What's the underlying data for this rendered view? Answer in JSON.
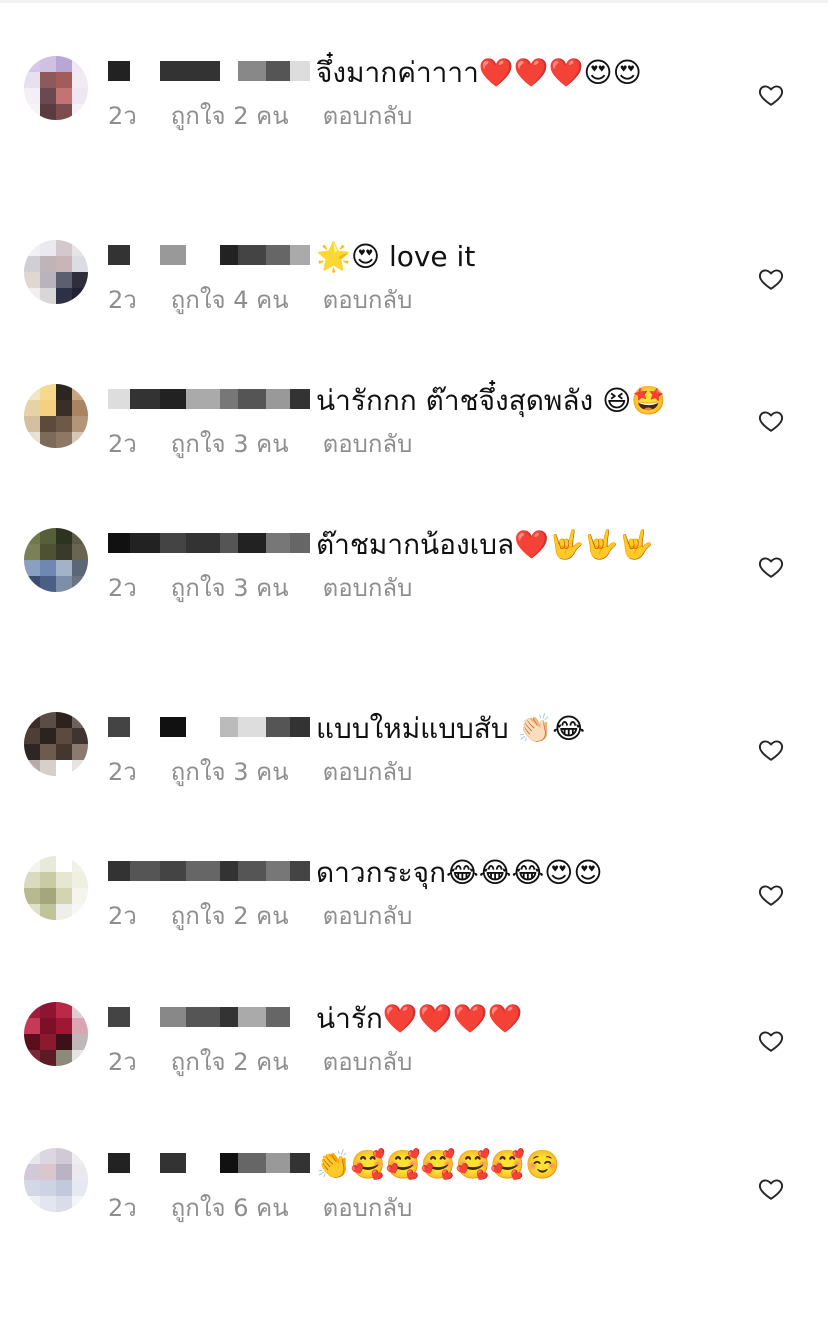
{
  "labels": {
    "likes_prefix": "ถูกใจ",
    "likes_suffix": "คน",
    "reply": "ตอบกลับ"
  },
  "comments": [
    {
      "text": "จึ๋งมากค่าาาา❤️❤️❤️😍😍",
      "time": "2ว",
      "likes_count": "2",
      "avatar_colors": [
        "#d8c6e8",
        "#cfc1e2",
        "#b9a6d4",
        "#efe7f5",
        "#e9e0ef",
        "#8c5a5a",
        "#a35b5b",
        "#f1ecf4",
        "#f4eef6",
        "#6b4a4f",
        "#c27474",
        "#eee7f1",
        "#f7f3f8",
        "#5a3b40",
        "#7d4c4f",
        "#f5f1f6"
      ],
      "mosaic": [
        "#222",
        "#fff",
        "#333",
        "#333",
        "#fff",
        "#888",
        "#555",
        "#ddd"
      ]
    },
    {
      "text": "🌟😍 love it",
      "time": "2ว",
      "likes_count": "4",
      "avatar_colors": [
        "#f1f1f1",
        "#e9e9ef",
        "#d3c8cc",
        "#e5e5e8",
        "#cfcfd6",
        "#bfb4b8",
        "#c9b5b5",
        "#dcdde4",
        "#e1d7d1",
        "#b9b4bc",
        "#5b5f70",
        "#2f2f3c",
        "#f3eeee",
        "#d8d6d6",
        "#2d3146",
        "#1f2233"
      ],
      "mosaic": [
        "#333",
        "#fff",
        "#999",
        "#fff",
        "#222",
        "#444",
        "#666",
        "#aaa"
      ]
    },
    {
      "text": "น่ารักกก ต๊าชจึ๋งสุดพลัง 😆🤩",
      "time": "2ว",
      "likes_count": "3",
      "avatar_colors": [
        "#f0e6c8",
        "#f6d98d",
        "#2b2620",
        "#c9a37e",
        "#e6d2a4",
        "#f3d181",
        "#3a2f27",
        "#a88462",
        "#d4bfa0",
        "#5c4a3c",
        "#6e5948",
        "#b39679",
        "#eae1d5",
        "#7c6a5b",
        "#8d7765",
        "#d7c8b6"
      ],
      "mosaic": [
        "#ddd",
        "#333",
        "#222",
        "#aaa",
        "#777",
        "#555",
        "#999",
        "#333"
      ]
    },
    {
      "text": "ต๊าชมากน้องเบล❤️🤟🤟🤟",
      "time": "2ว",
      "likes_count": "3",
      "avatar_colors": [
        "#6f7a4a",
        "#565f39",
        "#2d3321",
        "#5d5a46",
        "#7b8057",
        "#4c5233",
        "#3a3a2b",
        "#6a6552",
        "#8aa0c2",
        "#6f88b2",
        "#a4b2c9",
        "#5b6776",
        "#3c4c6a",
        "#4a5e86",
        "#7d8fa8",
        "#6b7380"
      ],
      "mosaic": [
        "#111",
        "#222",
        "#444",
        "#333",
        "#555",
        "#222",
        "#777",
        "#666"
      ]
    },
    {
      "text": "แบบใหม่แบบสับ 👏🏻😂",
      "time": "2ว",
      "likes_count": "3",
      "avatar_colors": [
        "#3a2e28",
        "#5b4d45",
        "#2c231f",
        "#6f625a",
        "#4d3f38",
        "#2a2320",
        "#5a4a40",
        "#3f3530",
        "#2e2622",
        "#6d5b50",
        "#44372f",
        "#8b7a70",
        "#b9aca6",
        "#d7cfca",
        "#ffffff",
        "#e9e3df"
      ],
      "mosaic": [
        "#444",
        "#fff",
        "#111",
        "#fff",
        "#bbb",
        "#ddd",
        "#555",
        "#333"
      ]
    },
    {
      "text": "ดาวกระจุก😂😂😂😍😍",
      "time": "2ว",
      "likes_count": "2",
      "avatar_colors": [
        "#f4f4ee",
        "#e8ead9",
        "#ffffff",
        "#f1f1ea",
        "#d9dbbf",
        "#c9cba4",
        "#e6e6d2",
        "#eef0e2",
        "#b7b98f",
        "#a4a67b",
        "#d2d4b4",
        "#f5f5ee",
        "#e0e1c9",
        "#c1c39a",
        "#eeeeea",
        "#f7f7f3"
      ],
      "mosaic": [
        "#333",
        "#555",
        "#444",
        "#666",
        "#333",
        "#555",
        "#777",
        "#444"
      ]
    },
    {
      "text": "น่ารัก❤️❤️❤️❤️",
      "time": "2ว",
      "likes_count": "2",
      "avatar_colors": [
        "#a11b3d",
        "#8d1532",
        "#b82a48",
        "#e4cbd1",
        "#c63a57",
        "#7c1029",
        "#a01735",
        "#d9a6b2",
        "#5b0e1e",
        "#8b1a31",
        "#3a1218",
        "#bfb8b9",
        "#7a2738",
        "#5c1b27",
        "#8c8a7b",
        "#e7e3e3"
      ],
      "mosaic": [
        "#444",
        "#fff",
        "#888",
        "#555",
        "#333",
        "#aaa",
        "#666",
        "#fff"
      ]
    },
    {
      "text": "👏🥰🥰🥰🥰🥰☺️",
      "time": "2ว",
      "likes_count": "6",
      "avatar_colors": [
        "#e9e6ee",
        "#dcd6e2",
        "#d2c9d7",
        "#f0edf2",
        "#cfc9d8",
        "#d9c7cd",
        "#b9b3c4",
        "#ece8f0",
        "#d4d8e6",
        "#cdd3e3",
        "#c2c9dd",
        "#e7e9f1",
        "#eef0f5",
        "#e3e6ef",
        "#d9dde9",
        "#f4f5f8"
      ],
      "mosaic": [
        "#222",
        "#fff",
        "#333",
        "#fff",
        "#111",
        "#666",
        "#999",
        "#333"
      ]
    }
  ]
}
